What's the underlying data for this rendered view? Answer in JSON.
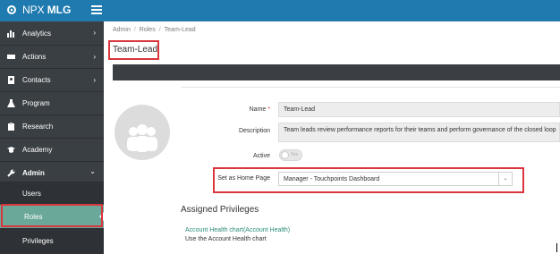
{
  "app": {
    "logo_prefix": "NPX",
    "logo_suffix": "MLG"
  },
  "sidebar": {
    "items": [
      {
        "label": "Analytics",
        "icon": "bar-chart-icon",
        "chevron": "›"
      },
      {
        "label": "Actions",
        "icon": "ticket-icon",
        "chevron": "›"
      },
      {
        "label": "Contacts",
        "icon": "contacts-icon",
        "chevron": "›"
      },
      {
        "label": "Program",
        "icon": "flask-icon"
      },
      {
        "label": "Research",
        "icon": "clipboard-icon"
      },
      {
        "label": "Academy",
        "icon": "graduation-cap-icon"
      },
      {
        "label": "Admin",
        "icon": "wrench-icon",
        "chevron": "⌄"
      }
    ],
    "subitems": [
      {
        "label": "Users"
      },
      {
        "label": "Roles"
      },
      {
        "label": "Privileges"
      }
    ]
  },
  "breadcrumb": {
    "items": [
      "Admin",
      "Roles",
      "Team-Lead"
    ],
    "separator": "/"
  },
  "page_title": "Team-Lead",
  "form": {
    "name_label": "Name",
    "required_mark": "*",
    "name_value": "Team-Lead",
    "description_label": "Description",
    "description_value": "Team leads review performance reports for their teams and perform governance of the closed loop",
    "active_label": "Active",
    "active_toggle_text": "Yes",
    "home_page_label": "Set as Home Page",
    "home_page_value": "Manager - Touchpoints Dashboard"
  },
  "privileges": {
    "heading": "Assigned Privileges",
    "items": [
      {
        "name": "Account Health chart(Account Health)",
        "description": "Use the Account Health chart"
      }
    ]
  },
  "colors": {
    "topbar": "#1f7aaf",
    "sidebar": "#3a3f44",
    "active": "#6aa99a",
    "highlight": "#d9363e",
    "link": "#2b8c7b"
  }
}
